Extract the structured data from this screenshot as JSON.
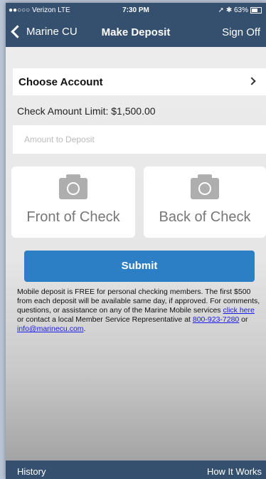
{
  "status_bar": {
    "carrier": "●●○○○ Verizon  LTE",
    "time": "7:30 PM",
    "right": "➚ ✱ 63%"
  },
  "nav": {
    "back_label": "Marine CU",
    "title": "Make Deposit",
    "sign_off": "Sign Off"
  },
  "form": {
    "choose_account": "Choose Account",
    "limit": "Check Amount Limit: $1,500.00",
    "amount_placeholder": "Amount to Deposit",
    "front_label": "Front of Check",
    "back_label": "Back of Check",
    "submit": "Submit"
  },
  "info": {
    "text1": "Mobile deposit is FREE for personal checking members. The first $500 from each deposit will be available same day, if approved. For comments, questions, or assistance on any of the Marine Mobile services ",
    "link1": "click here",
    "text2": " or contact a local Member Service Representative at ",
    "phone": "800-923-7280",
    "text3": " or ",
    "email": "info@marinecu.com",
    "text4": "."
  },
  "tabs": {
    "history": "History",
    "how_it_works": "How It Works"
  },
  "colors": {
    "bar": "#35506f",
    "accent": "#2d7fc5"
  },
  "battery_level": 0.63
}
